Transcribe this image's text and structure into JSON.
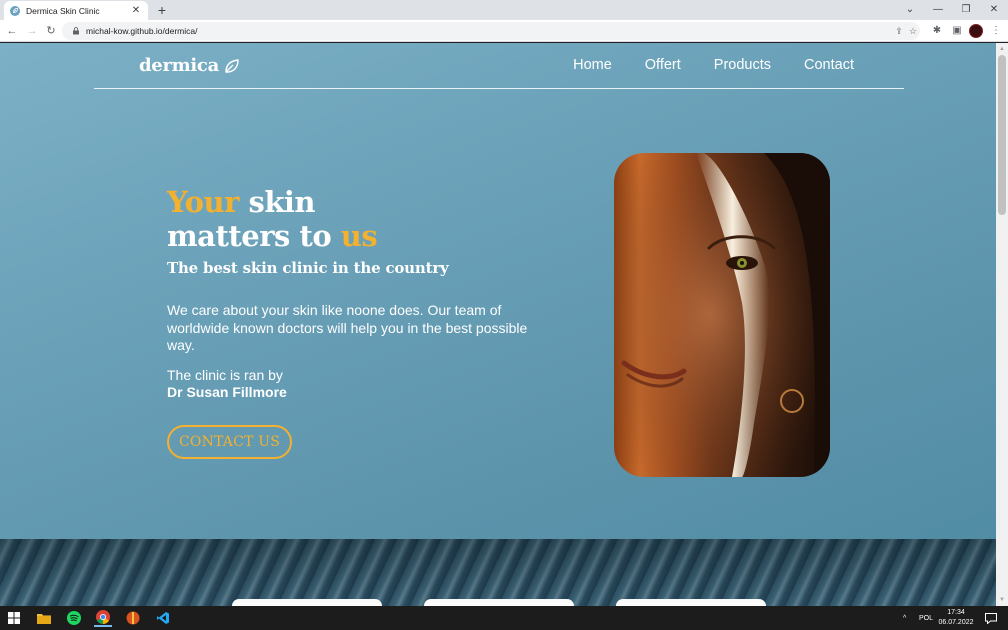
{
  "browser": {
    "tab_title": "Dermica Skin Clinic",
    "tab_close": "✕",
    "new_tab": "+",
    "url": "michal-kow.github.io/dermica/",
    "window_controls": [
      "⌄",
      "—",
      "❐",
      "✕"
    ]
  },
  "site": {
    "logo_text": "dermica",
    "nav": [
      "Home",
      "Offert",
      "Products",
      "Contact"
    ],
    "headline": {
      "part1_accent": "Your",
      "part1_rest": " skin",
      "part2_rest": "matters to ",
      "part2_accent": "us"
    },
    "subtitle": "The best skin clinic in the country",
    "description": "We care about your skin like noone does. Our team of worldwide known doctors will help you in the best possible way.",
    "ran_by": "The clinic is ran by",
    "doctor": "Dr Susan Fillmore",
    "cta": "CONTACT US",
    "colors": {
      "accent": "#f4b02f",
      "background": "#6aa1b8",
      "text": "#ffffff"
    }
  },
  "taskbar": {
    "language": "POL",
    "time": "17:34",
    "date": "06.07.2022"
  }
}
